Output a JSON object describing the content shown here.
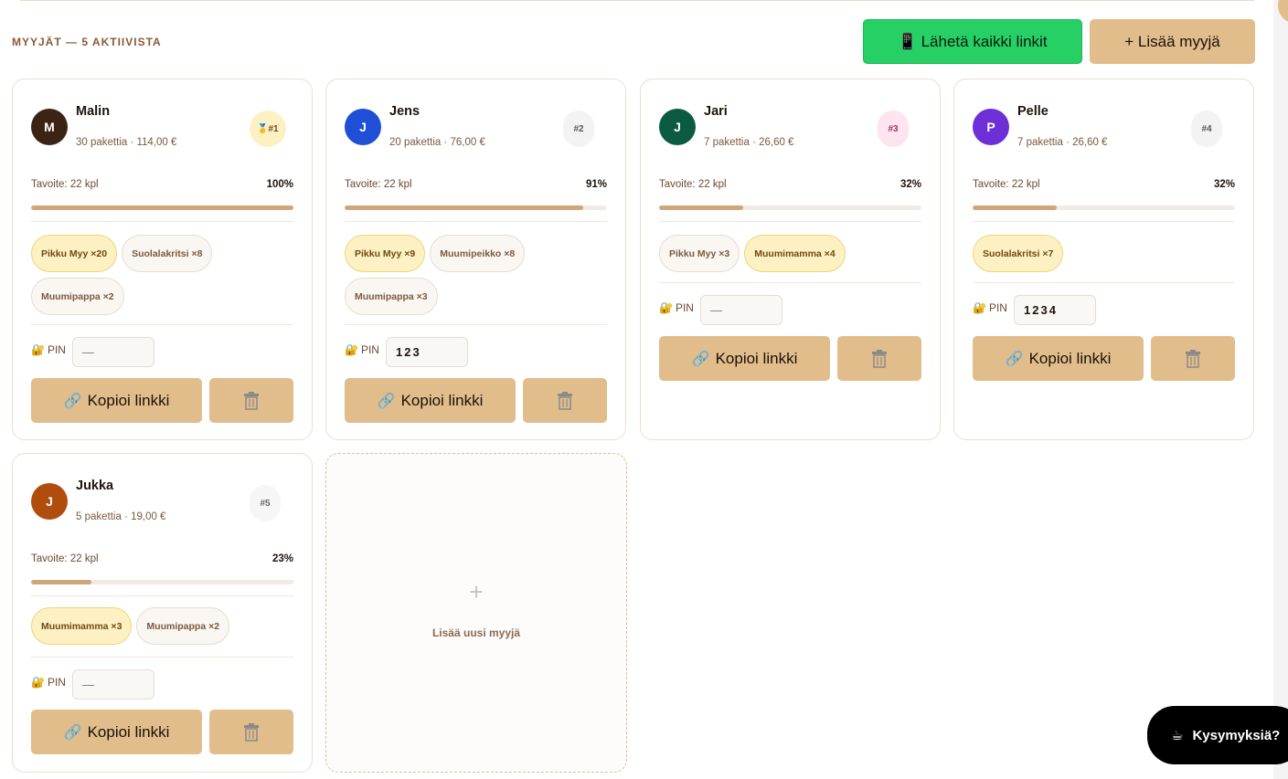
{
  "header": {
    "section_title": "MYYJÄT — 5 AKTIIVISTA",
    "send_all_label": "Lähetä kaikki linkit",
    "add_seller_label": "+ Lisää myyjä"
  },
  "colors": {
    "accent": "#e2bd8c",
    "send_green": "#27d065",
    "progress": "#cfa679",
    "chip_highlight": "#fdf1c4"
  },
  "sellers": [
    {
      "initial": "M",
      "name": "Malin",
      "stats": "30 pakettia · 114,00 €",
      "rank": "🥇#1",
      "goal": "Tavoite: 22 kpl",
      "percent_label": "100%",
      "progress": 1.0,
      "chips": [
        {
          "label": "Pikku Myy ×20",
          "style": "hi"
        },
        {
          "label": "Suolalakritsi ×8",
          "style": "lo"
        },
        {
          "label": "Muumipappa ×2",
          "style": "lo"
        }
      ],
      "pin_label": "PIN",
      "pin_value": "—",
      "copy_label": "Kopioi linkki",
      "avatar_color": "#3b2414"
    },
    {
      "initial": "J",
      "name": "Jens",
      "stats": "20 pakettia · 76,00 €",
      "rank": "#2",
      "goal": "Tavoite: 22 kpl",
      "percent_label": "91%",
      "progress": 0.91,
      "chips": [
        {
          "label": "Pikku Myy ×9",
          "style": "hi"
        },
        {
          "label": "Muumipeikko ×8",
          "style": "lo"
        },
        {
          "label": "Muumipappa ×3",
          "style": "lo"
        }
      ],
      "pin_label": "PIN",
      "pin_value": "123",
      "copy_label": "Kopioi linkki",
      "avatar_color": "#1e4fd6"
    },
    {
      "initial": "J",
      "name": "Jari",
      "stats": "7 pakettia · 26,60 €",
      "rank": "#3",
      "goal": "Tavoite: 22 kpl",
      "percent_label": "32%",
      "progress": 0.32,
      "chips": [
        {
          "label": "Pikku Myy ×3",
          "style": "lo"
        },
        {
          "label": "Muumimamma ×4",
          "style": "hi"
        }
      ],
      "pin_label": "PIN",
      "pin_value": "—",
      "copy_label": "Kopioi linkki",
      "avatar_color": "#0b5b43"
    },
    {
      "initial": "P",
      "name": "Pelle",
      "stats": "7 pakettia · 26,60 €",
      "rank": "#4",
      "goal": "Tavoite: 22 kpl",
      "percent_label": "32%",
      "progress": 0.32,
      "chips": [
        {
          "label": "Suolalakritsi ×7",
          "style": "hi"
        }
      ],
      "pin_label": "PIN",
      "pin_value": "1234",
      "copy_label": "Kopioi linkki",
      "avatar_color": "#6d2fd6"
    },
    {
      "initial": "J",
      "name": "Jukka",
      "stats": "5 pakettia · 19,00 €",
      "rank": "#5",
      "goal": "Tavoite: 22 kpl",
      "percent_label": "23%",
      "progress": 0.23,
      "chips": [
        {
          "label": "Muumimamma ×3",
          "style": "hi"
        },
        {
          "label": "Muumipappa ×2",
          "style": "lo"
        }
      ],
      "pin_label": "PIN",
      "pin_value": "—",
      "copy_label": "Kopioi linkki",
      "avatar_color": "#b04d0c"
    }
  ],
  "add_card": {
    "plus": "+",
    "label": "Lisää uusi myyjä"
  },
  "help": {
    "label": "Kysymyksiä?"
  }
}
